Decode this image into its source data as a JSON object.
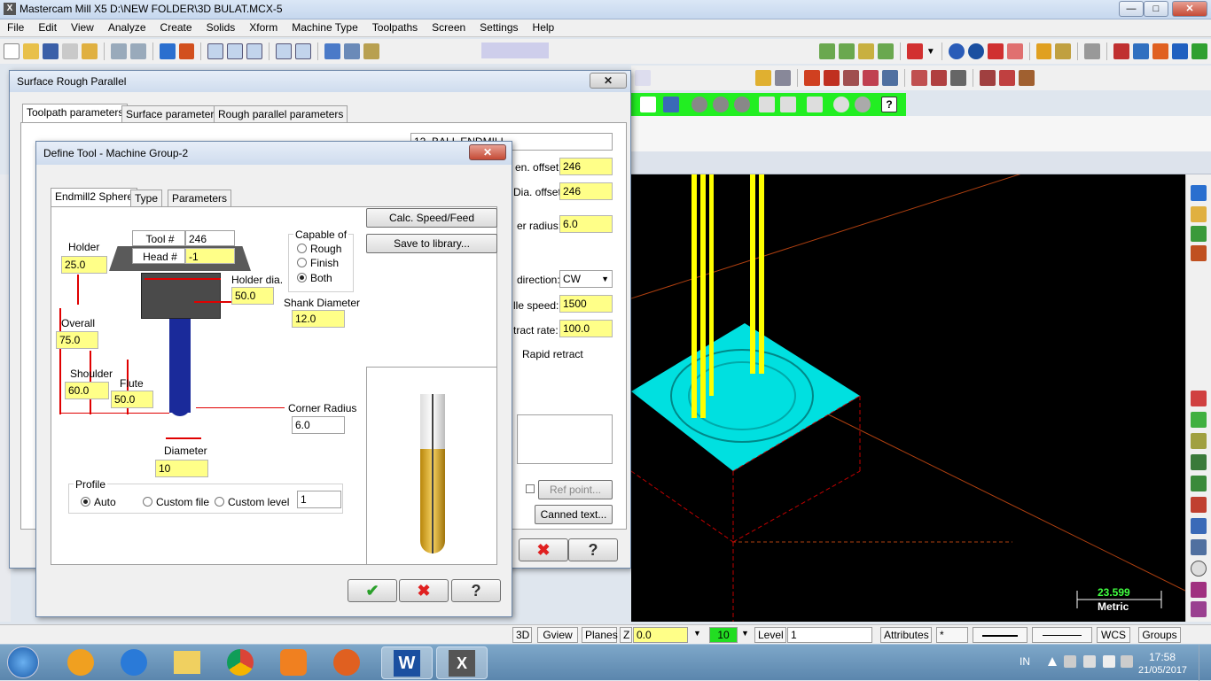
{
  "window": {
    "title": "Mastercam Mill X5  D:\\NEW FOLDER\\3D BULAT.MCX-5"
  },
  "menu": [
    "File",
    "Edit",
    "View",
    "Analyze",
    "Create",
    "Solids",
    "Xform",
    "Machine Type",
    "Toolpaths",
    "Screen",
    "Settings",
    "Help"
  ],
  "outer_dialog": {
    "title": "Surface Rough Parallel",
    "tabs": [
      "Toolpath parameters",
      "Surface parameters",
      "Rough parallel parameters"
    ],
    "tool_name": "12. BALL ENDMILL",
    "len_offset_label": "en. offset:",
    "len_offset": "246",
    "dia_offset_label": "Dia. offset:",
    "dia_offset": "246",
    "corner_radius_label": "er radius:",
    "corner_radius": "6.0",
    "direction_label": "direction:",
    "direction": "CW",
    "spindle_label": "lle speed:",
    "spindle": "1500",
    "retract_label": "tract rate:",
    "retract": "100.0",
    "rapid_retract": "Rapid retract",
    "ref_point": "Ref point...",
    "canned_text": "Canned text..."
  },
  "define_tool": {
    "title": "Define Tool - Machine Group-2",
    "tabs": [
      "Endmill2 Sphere",
      "Type",
      "Parameters"
    ],
    "tool_num_label": "Tool #",
    "tool_num": "246",
    "head_num_label": "Head #",
    "head_num": "-1",
    "holder_label": "Holder",
    "holder": "25.0",
    "holder_dia_label": "Holder dia.",
    "holder_dia": "50.0",
    "shank_label": "Shank Diameter",
    "shank": "12.0",
    "overall_label": "Overall",
    "overall": "75.0",
    "shoulder_label": "Shoulder",
    "shoulder": "60.0",
    "flute_label": "Flute",
    "flute": "50.0",
    "corner_label": "Corner Radius",
    "corner": "6.0",
    "diameter_label": "Diameter",
    "diameter": "10",
    "capable_label": "Capable of",
    "capable": [
      "Rough",
      "Finish",
      "Both"
    ],
    "calc_btn": "Calc. Speed/Feed",
    "save_btn": "Save to library...",
    "profile_label": "Profile",
    "profile_opts": [
      "Auto",
      "Custom file",
      "Custom level"
    ],
    "level_value": "1"
  },
  "viewport": {
    "scale_value": "23.599",
    "scale_unit": "Metric"
  },
  "status": {
    "btn_3d": "3D",
    "gview": "Gview",
    "planes": "Planes",
    "z_label": "Z",
    "z_value": "0.0",
    "color_value": "10",
    "level_label": "Level",
    "level_value": "1",
    "attributes": "Attributes",
    "point_style": "*",
    "wcs": "WCS",
    "groups": "Groups"
  },
  "taskbar": {
    "lang": "IN",
    "time": "17:58",
    "date": "21/05/2017"
  }
}
